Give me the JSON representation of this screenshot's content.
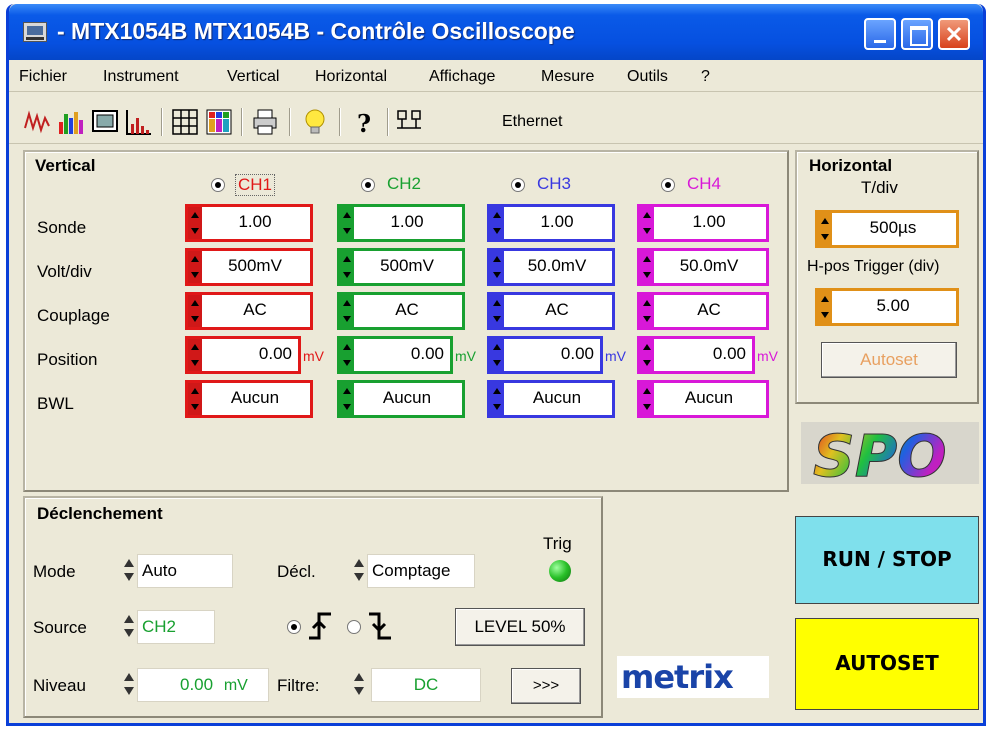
{
  "window": {
    "title": "- MTX1054B MTX1054B - Contrôle Oscilloscope",
    "close_glyph": "✕"
  },
  "menu": [
    "Fichier",
    "Instrument",
    "Vertical",
    "Horizontal",
    "Affichage",
    "Mesure",
    "Outils",
    "?"
  ],
  "toolbar": {
    "icons": [
      "waveform-icon",
      "spectrum-icon",
      "screen-icon",
      "histogram-icon",
      "grid-icon",
      "color-palette-icon",
      "print-icon",
      "lightbulb-icon",
      "help-icon",
      "network-icon"
    ],
    "connection_label": "Ethernet"
  },
  "vertical": {
    "title": "Vertical",
    "row_labels": [
      "Sonde",
      "Volt/div",
      "Couplage",
      "Position",
      "BWL"
    ],
    "channels": [
      {
        "label": "CH1",
        "color": "#e01818",
        "sonde": "1.00",
        "volt_div": "500mV",
        "couplage": "AC",
        "position": "0.00",
        "unit": "mV",
        "bwl": "Aucun"
      },
      {
        "label": "CH2",
        "color": "#18a030",
        "sonde": "1.00",
        "volt_div": "500mV",
        "couplage": "AC",
        "position": "0.00",
        "unit": "mV",
        "bwl": "Aucun"
      },
      {
        "label": "CH3",
        "color": "#3838e0",
        "sonde": "1.00",
        "volt_div": "50.0mV",
        "couplage": "AC",
        "position": "0.00",
        "unit": "mV",
        "bwl": "Aucun"
      },
      {
        "label": "CH4",
        "color": "#d818d8",
        "sonde": "1.00",
        "volt_div": "50.0mV",
        "couplage": "AC",
        "position": "0.00",
        "unit": "mV",
        "bwl": "Aucun"
      }
    ]
  },
  "horizontal": {
    "title": "Horizontal",
    "tdiv_label": "T/div",
    "tdiv_value": "500µs",
    "hpos_label": "H-pos Trigger (div)",
    "hpos_value": "5.00",
    "autoset_label": "Autoset",
    "color": "#e09018"
  },
  "logo": "SPO",
  "trigger": {
    "title": "Déclenchement",
    "mode_label": "Mode",
    "mode_value": "Auto",
    "decl_label": "Décl.",
    "decl_value": "Comptage",
    "trig_label": "Trig",
    "source_label": "Source",
    "source_value": "CH2",
    "level_button": "LEVEL 50%",
    "niveau_label": "Niveau",
    "niveau_value": "0.00",
    "niveau_unit": "mV",
    "filtre_label": "Filtre:",
    "filtre_value": "DC",
    "more_button": ">>>",
    "slope": "rising"
  },
  "brand": "metrix",
  "buttons": {
    "run_stop": "RUN / STOP",
    "autoset": "AUTOSET"
  },
  "colors": {
    "run_stop_bg": "#7fe0ec",
    "autoset_bg": "#ffff00",
    "trig_led": "#28c028",
    "green_text": "#18a030"
  }
}
